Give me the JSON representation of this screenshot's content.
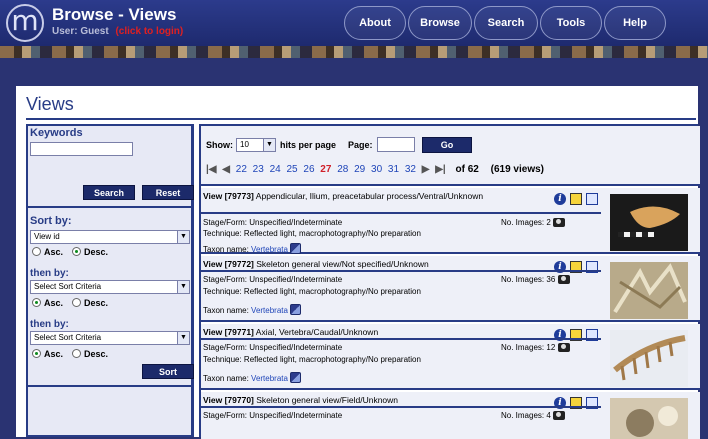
{
  "header": {
    "logo": "m",
    "title": "Browse - Views",
    "user_text": "User: Guest",
    "login_text": "(click to login)",
    "nav": [
      "About",
      "Browse",
      "Search",
      "Tools",
      "Help"
    ]
  },
  "page": {
    "title": "Views"
  },
  "sidebar": {
    "keywords_label": "Keywords",
    "keywords_value": "",
    "search_label": "Search",
    "reset_label": "Reset",
    "sort_by_label": "Sort by:",
    "sort1_value": "View id",
    "then_by_label": "then by:",
    "sort2_value": "Select Sort Criteria",
    "sort3_value": "Select Sort Criteria",
    "asc_label": "Asc.",
    "desc_label": "Desc.",
    "sort_button": "Sort",
    "sort1_order": "desc",
    "sort2_order": "asc",
    "sort3_order": "asc"
  },
  "toolbar": {
    "show_label": "Show:",
    "show_value": "10",
    "hits_label": "hits per page",
    "page_label": "Page:",
    "page_value": "",
    "go_label": "Go",
    "pages": [
      "22",
      "23",
      "24",
      "25",
      "26",
      "27",
      "28",
      "29",
      "30",
      "31",
      "32"
    ],
    "current_page": "27",
    "of_total": "of 62",
    "count_text": "(619 views)"
  },
  "records": [
    {
      "id": "View [79773]",
      "desc": "Appendicular, Ilium, preacetabular process/Ventral/Unknown",
      "stage": "Stage/Form: Unspecified/Indeterminate",
      "technique": "Technique: Reflected light, macrophotography/No preparation",
      "taxon_label": "Taxon name:",
      "taxon": "Vertebrata",
      "images_label": "No. Images:",
      "images": "2"
    },
    {
      "id": "View [79772]",
      "desc": "Skeleton general view/Not specified/Unknown",
      "stage": "Stage/Form: Unspecified/Indeterminate",
      "technique": "Technique: Reflected light, macrophotography/No preparation",
      "taxon_label": "Taxon name:",
      "taxon": "Vertebrata",
      "images_label": "No. Images:",
      "images": "36"
    },
    {
      "id": "View [79771]",
      "desc": "Axial, Vertebra/Caudal/Unknown",
      "stage": "Stage/Form: Unspecified/Indeterminate",
      "technique": "Technique: Reflected light, macrophotography/No preparation",
      "taxon_label": "Taxon name:",
      "taxon": "Vertebrata",
      "images_label": "No. Images:",
      "images": "12"
    },
    {
      "id": "View [79770]",
      "desc": "Skeleton general view/Field/Unknown",
      "stage": "Stage/Form: Unspecified/Indeterminate",
      "technique": "",
      "taxon_label": "",
      "taxon": "",
      "images_label": "No. Images:",
      "images": "4"
    }
  ],
  "colors": {
    "nav_bg": "#1e2a6e",
    "panel_bg": "#e7e9f5",
    "accent": "#283c86",
    "link": "#1f45b8",
    "current_page": "#d0202a"
  }
}
